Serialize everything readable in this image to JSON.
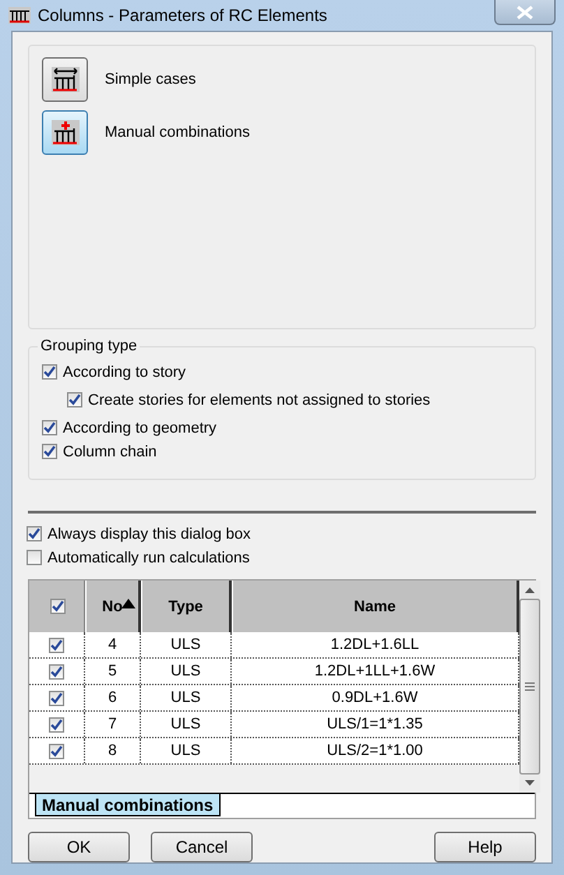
{
  "window": {
    "title": "Columns - Parameters of RC Elements"
  },
  "modes": [
    {
      "label": "Simple cases",
      "selected": false
    },
    {
      "label": "Manual combinations",
      "selected": true
    }
  ],
  "grouping": {
    "title": "Grouping type",
    "options": [
      {
        "label": "According to story",
        "checked": true,
        "children": [
          {
            "label": "Create stories for elements not assigned to stories",
            "checked": true
          }
        ]
      },
      {
        "label": "According to geometry",
        "checked": true
      },
      {
        "label": "Column chain",
        "checked": true
      }
    ]
  },
  "options": [
    {
      "label": "Always display this dialog box",
      "checked": true
    },
    {
      "label": "Automatically run calculations",
      "checked": false
    }
  ],
  "table": {
    "all_checked": true,
    "columns": [
      {
        "label": "No",
        "sorted": true
      },
      {
        "label": "Type",
        "sorted": false
      },
      {
        "label": "Name",
        "sorted": false
      }
    ],
    "rows": [
      {
        "checked": true,
        "no": "4",
        "type": "ULS",
        "name": "1.2DL+1.6LL"
      },
      {
        "checked": true,
        "no": "5",
        "type": "ULS",
        "name": "1.2DL+1LL+1.6W"
      },
      {
        "checked": true,
        "no": "6",
        "type": "ULS",
        "name": "0.9DL+1.6W"
      },
      {
        "checked": true,
        "no": "7",
        "type": "ULS",
        "name": "ULS/1=1*1.35"
      },
      {
        "checked": true,
        "no": "8",
        "type": "ULS",
        "name": "ULS/2=1*1.00"
      }
    ]
  },
  "tabs": [
    {
      "label": "Manual combinations",
      "selected": true
    }
  ],
  "buttons": [
    "OK",
    "Cancel",
    "Help"
  ]
}
